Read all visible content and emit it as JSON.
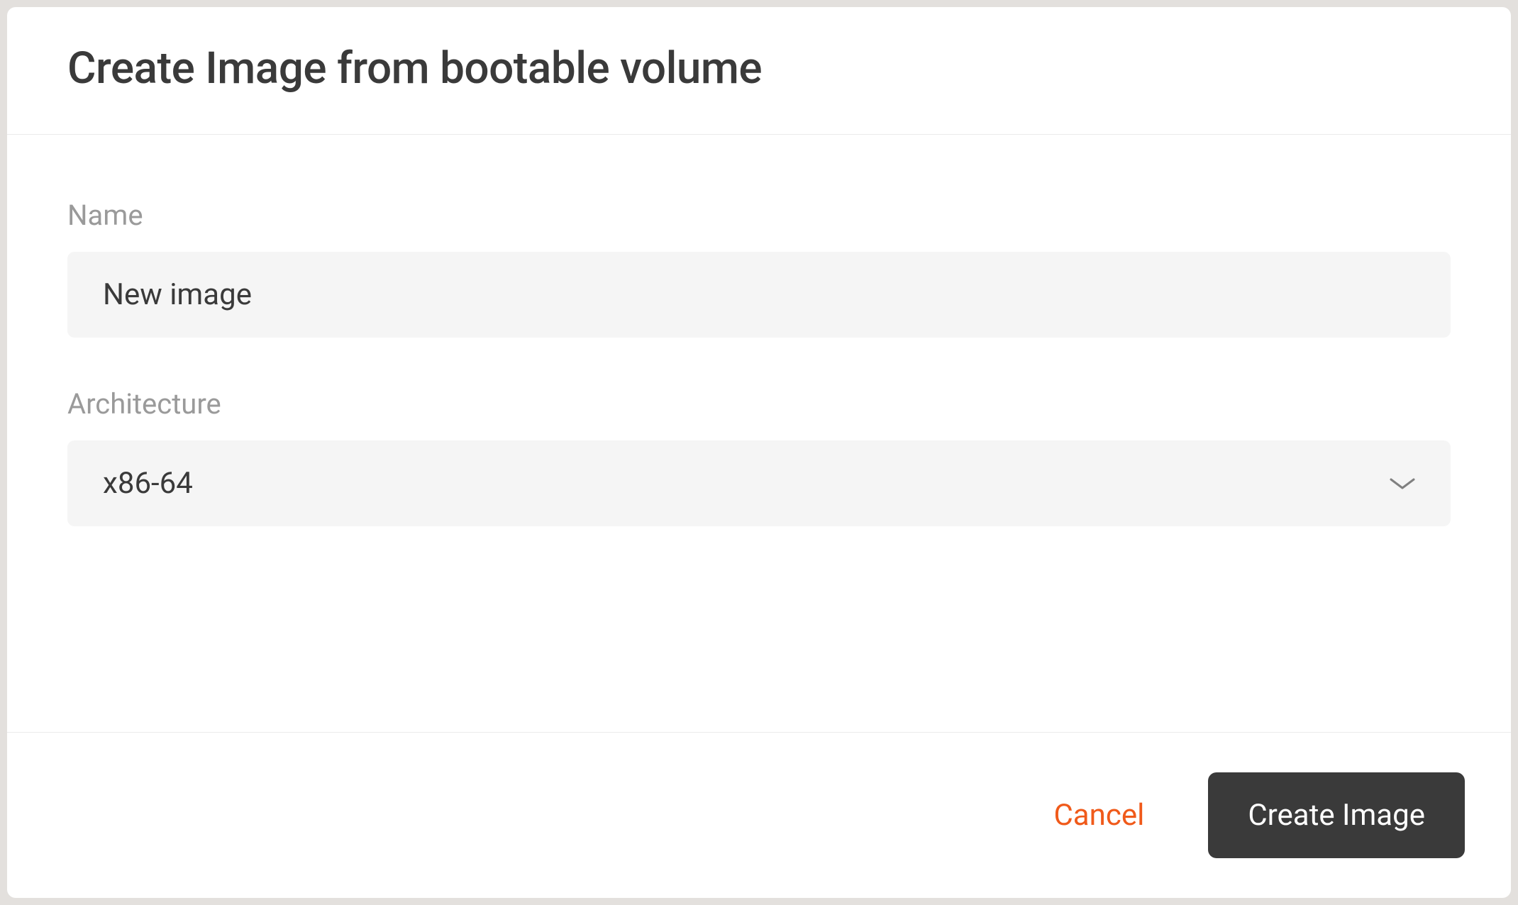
{
  "modal": {
    "title": "Create Image from bootable volume"
  },
  "form": {
    "name": {
      "label": "Name",
      "value": "New image"
    },
    "architecture": {
      "label": "Architecture",
      "selected": "x86-64"
    }
  },
  "footer": {
    "cancel_label": "Cancel",
    "submit_label": "Create Image"
  }
}
